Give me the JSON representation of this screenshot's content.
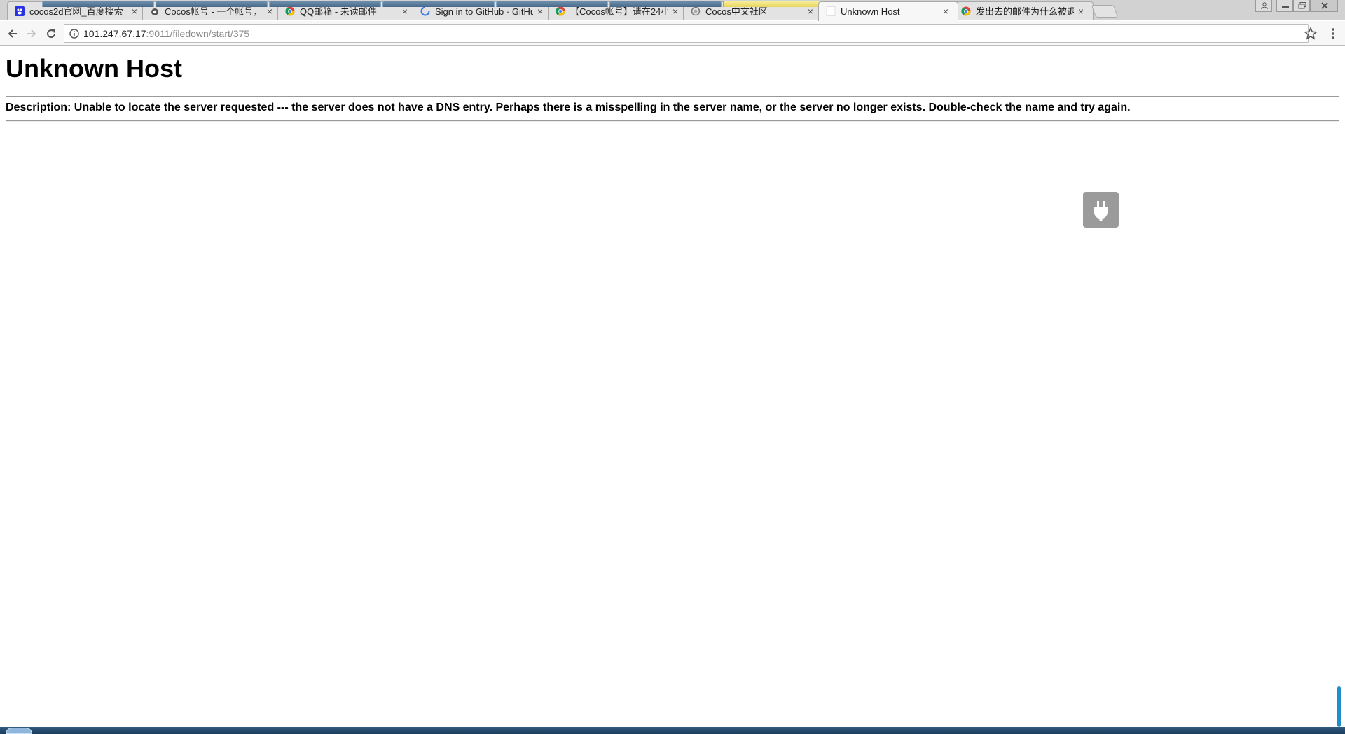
{
  "browser": {
    "tabs": [
      {
        "title": "cocos2d官网_百度搜索",
        "icon": "baidu-paw-icon",
        "active": false
      },
      {
        "title": "Cocos帐号 - 一个帐号，",
        "icon": "cocos-logo-icon",
        "active": false
      },
      {
        "title": "QQ邮箱 - 未读邮件",
        "icon": "chrome-icon",
        "active": false
      },
      {
        "title": "Sign in to GitHub · GitHub",
        "icon": "loading-spinner-icon",
        "active": false
      },
      {
        "title": "【Cocos帐号】请在24小",
        "icon": "chrome-icon",
        "active": false
      },
      {
        "title": "Cocos中文社区",
        "icon": "globe-icon",
        "active": false
      },
      {
        "title": "Unknown Host",
        "icon": "blank-page-icon",
        "active": true
      },
      {
        "title": "发出去的邮件为什么被退",
        "icon": "chrome-icon",
        "active": false
      }
    ],
    "address": {
      "host": "101.247.67.17",
      "rest": ":9011/filedown/start/375"
    }
  },
  "page": {
    "title": "Unknown Host",
    "description": "Description: Unable to locate the server requested --- the server does not have a DNS entry. Perhaps there is a misspelling in the server name, or the server no longer exists. Double-check the name and try again."
  },
  "colors": {
    "tabstrip": "#d2d2d2",
    "toolbar": "#f7f7f7",
    "extension_icon": "#9b9b9b",
    "taskbar": "#1c3d5c"
  }
}
